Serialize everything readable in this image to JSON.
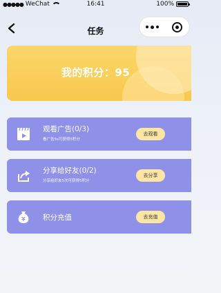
{
  "status_bar": {
    "signal": "●●●●●",
    "carrier": "WeChat",
    "time": "16:41",
    "battery_percent": "100%"
  },
  "nav": {
    "title": "任务"
  },
  "points": {
    "text": "我的积分：95"
  },
  "tasks": [
    {
      "title": "观看广告(0/3)",
      "subtitle": "看广告5s可获得5积分",
      "button": "去观看",
      "icon": "video-icon"
    },
    {
      "title": "分享给好友(0/2)",
      "subtitle": "分享给好友5次可获得5积分",
      "button": "去分享",
      "icon": "share-icon"
    },
    {
      "title": "积分充值",
      "subtitle": "",
      "button": "去充值",
      "icon": "money-bag-icon"
    }
  ],
  "colors": {
    "card": "#8f90e8",
    "banner": "#f9c84d",
    "button": "#fde5a3"
  }
}
